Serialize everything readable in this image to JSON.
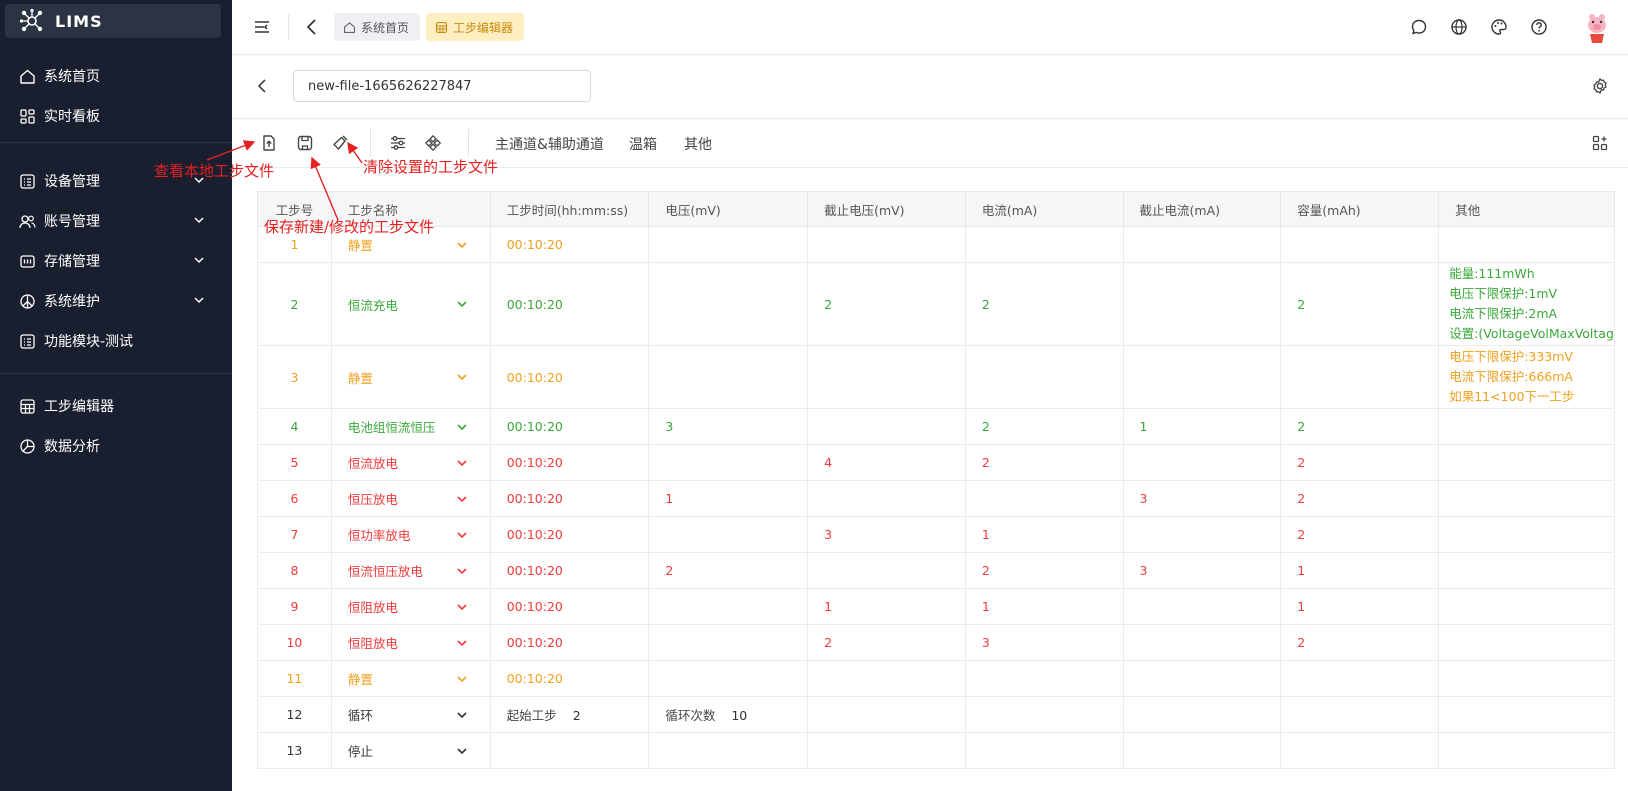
{
  "app": {
    "title": "LIMS"
  },
  "sidebar": {
    "items": [
      {
        "label": "系统首页",
        "icon": "home-icon"
      },
      {
        "label": "实时看板",
        "icon": "dashboard-icon"
      },
      {
        "label": "设备管理",
        "icon": "list-icon",
        "expandable": true
      },
      {
        "label": "账号管理",
        "icon": "users-icon",
        "expandable": true
      },
      {
        "label": "存储管理",
        "icon": "storage-icon",
        "expandable": true
      },
      {
        "label": "系统维护",
        "icon": "maintenance-icon",
        "expandable": true
      },
      {
        "label": "功能模块-测试",
        "icon": "list-icon"
      },
      {
        "label": "工步编辑器",
        "icon": "grid-icon"
      },
      {
        "label": "数据分析",
        "icon": "pie-chart-icon"
      }
    ]
  },
  "header": {
    "tabs": [
      {
        "label": "系统首页",
        "icon": "home-icon"
      },
      {
        "label": "工步编辑器",
        "icon": "grid-icon",
        "active": true
      }
    ]
  },
  "file": {
    "name": "new-file-1665626227847"
  },
  "toolbar": {
    "tabs": [
      "主通道&辅助通道",
      "温箱",
      "其他"
    ]
  },
  "annotations": {
    "view_local": "查看本地工步文件",
    "save_file": "保存新建/修改的工步文件",
    "clear_settings": "清除设置的工步文件"
  },
  "table": {
    "columns": [
      "工步号",
      "工步名称",
      "工步时间(hh:mm:ss)",
      "电压(mV)",
      "截止电压(mV)",
      "电流(mA)",
      "截止电流(mA)",
      "容量(mAh)",
      "其他"
    ],
    "rows": [
      {
        "no": "1",
        "name": "静置",
        "time": "00:10:20",
        "voltage": "",
        "cutoff_voltage": "",
        "current": "",
        "cutoff_current": "",
        "capacity": "",
        "other": [],
        "color": "#f0a020"
      },
      {
        "no": "2",
        "name": "恒流充电",
        "time": "00:10:20",
        "voltage": "",
        "cutoff_voltage": "2",
        "current": "2",
        "cutoff_current": "",
        "capacity": "2",
        "other": [
          "能量:111mWh",
          "电压下限保护:1mV",
          "电流下限保护:2mA",
          "设置:(VoltageVolMaxVoltag"
        ],
        "color": "#3aa83a"
      },
      {
        "no": "3",
        "name": "静置",
        "time": "00:10:20",
        "voltage": "",
        "cutoff_voltage": "",
        "current": "",
        "cutoff_current": "",
        "capacity": "",
        "other": [
          "电压下限保护:333mV",
          "电流下限保护:666mA",
          "如果11<100下一工步"
        ],
        "color": "#f0a020"
      },
      {
        "no": "4",
        "name": "电池组恒流恒压",
        "time": "00:10:20",
        "voltage": "3",
        "cutoff_voltage": "",
        "current": "2",
        "cutoff_current": "1",
        "capacity": "2",
        "other": [],
        "color": "#3aa83a"
      },
      {
        "no": "5",
        "name": "恒流放电",
        "time": "00:10:20",
        "voltage": "",
        "cutoff_voltage": "4",
        "current": "2",
        "cutoff_current": "",
        "capacity": "2",
        "other": [],
        "color": "#ee3b3b"
      },
      {
        "no": "6",
        "name": "恒压放电",
        "time": "00:10:20",
        "voltage": "1",
        "cutoff_voltage": "",
        "current": "",
        "cutoff_current": "3",
        "capacity": "2",
        "other": [],
        "color": "#ee3b3b"
      },
      {
        "no": "7",
        "name": "恒功率放电",
        "time": "00:10:20",
        "voltage": "",
        "cutoff_voltage": "3",
        "current": "1",
        "cutoff_current": "",
        "capacity": "2",
        "other": [],
        "color": "#ee3b3b"
      },
      {
        "no": "8",
        "name": "恒流恒压放电",
        "time": "00:10:20",
        "voltage": "2",
        "cutoff_voltage": "",
        "current": "2",
        "cutoff_current": "3",
        "capacity": "1",
        "other": [],
        "color": "#ee3b3b"
      },
      {
        "no": "9",
        "name": "恒阻放电",
        "time": "00:10:20",
        "voltage": "",
        "cutoff_voltage": "1",
        "current": "1",
        "cutoff_current": "",
        "capacity": "1",
        "other": [],
        "color": "#ee3b3b"
      },
      {
        "no": "10",
        "name": "恒阻放电",
        "time": "00:10:20",
        "voltage": "",
        "cutoff_voltage": "2",
        "current": "3",
        "cutoff_current": "",
        "capacity": "2",
        "other": [],
        "color": "#ee3b3b"
      },
      {
        "no": "11",
        "name": "静置",
        "time": "00:10:20",
        "voltage": "",
        "cutoff_voltage": "",
        "current": "",
        "cutoff_current": "",
        "capacity": "",
        "other": [],
        "color": "#f0a020"
      }
    ],
    "cycle_row": {
      "no": "12",
      "name": "循环",
      "start_label": "起始工步",
      "start_value": "2",
      "count_label": "循环次数",
      "count_value": "10"
    },
    "stop_row": {
      "no": "13",
      "name": "停止"
    }
  }
}
